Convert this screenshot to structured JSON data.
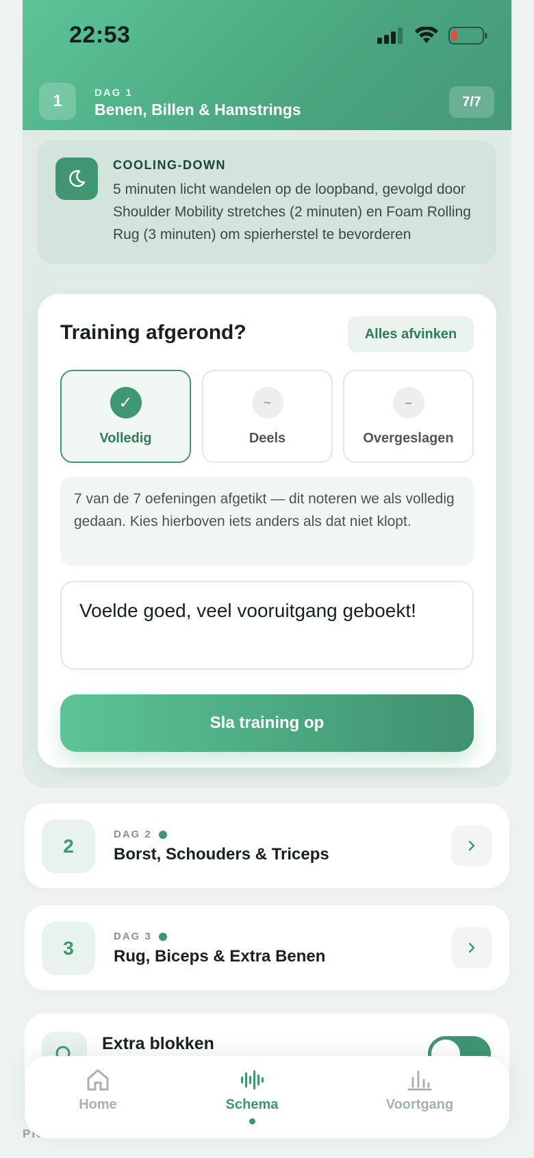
{
  "status_bar": {
    "time": "22:53"
  },
  "header": {
    "day_number": "1",
    "day_label": "DAG 1",
    "title": "Benen, Billen & Hamstrings",
    "count": "7/7"
  },
  "cooldown": {
    "icon": "moon-icon",
    "label": "COOLING-DOWN",
    "text": "5 minuten licht wandelen op de loopband, gevolgd door Shoulder Mobility stretches (2 minuten) en Foam Rolling Rug (3 minuten) om spierherstel te bevorderen"
  },
  "training": {
    "title": "Training afgerond?",
    "check_all_label": "Alles afvinken",
    "options": [
      {
        "symbol": "✓",
        "label": "Volledig",
        "selected": true
      },
      {
        "symbol": "~",
        "label": "Deels",
        "selected": false
      },
      {
        "symbol": "–",
        "label": "Overgeslagen",
        "selected": false
      }
    ],
    "info": "7 van de 7 oefeningen afgetikt — dit noteren we als volledig gedaan. Kies hierboven iets anders als dat niet klopt.",
    "note": "Voelde goed, veel vooruitgang geboekt!",
    "save_label": "Sla training op"
  },
  "days": [
    {
      "number": "2",
      "label": "DAG 2",
      "title": "Borst, Schouders & Triceps"
    },
    {
      "number": "3",
      "label": "DAG 3",
      "title": "Rug, Biceps & Extra Benen"
    }
  ],
  "extra": {
    "title": "Extra blokken",
    "toggle_on": true
  },
  "footer_text": "PRO",
  "nav": {
    "items": [
      {
        "label": "Home",
        "icon": "home-icon",
        "active": false
      },
      {
        "label": "Schema",
        "icon": "waveform-icon",
        "active": true
      },
      {
        "label": "Voortgang",
        "icon": "bar-chart-icon",
        "active": false
      }
    ]
  },
  "colors": {
    "accent": "#3f9672",
    "header_gradient_start": "#5cc497",
    "header_gradient_end": "#45997a",
    "battery_low": "#e74c3c"
  }
}
